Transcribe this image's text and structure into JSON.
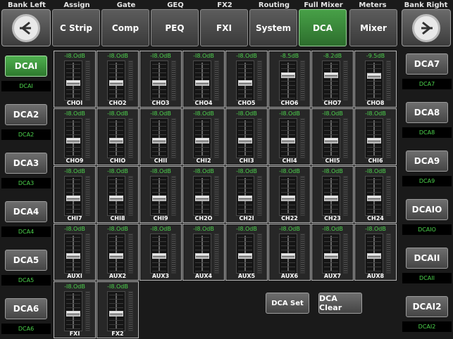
{
  "header": {
    "labels": [
      "Bank Left",
      "Assign",
      "Gate",
      "GEQ",
      "FX2",
      "Routing",
      "Full Mixer",
      "Meters",
      "Bank Right"
    ],
    "tabs": [
      {
        "label": "C Strip",
        "active": false
      },
      {
        "label": "Comp",
        "active": false
      },
      {
        "label": "PEQ",
        "active": false
      },
      {
        "label": "FXI",
        "active": false
      },
      {
        "label": "System",
        "active": false
      },
      {
        "label": "DCA",
        "active": true
      },
      {
        "label": "Mixer",
        "active": false
      }
    ],
    "bank_left_icon": "arrow-left-circle-icon",
    "bank_right_icon": "arrow-right-circle-icon"
  },
  "left_dca": [
    {
      "label": "DCAI",
      "tag": "DCAI",
      "active": true
    },
    {
      "label": "DCA2",
      "tag": "DCA2",
      "active": false
    },
    {
      "label": "DCA3",
      "tag": "DCA3",
      "active": false
    },
    {
      "label": "DCA4",
      "tag": "DCA4",
      "active": false
    },
    {
      "label": "DCA5",
      "tag": "DCA5",
      "active": false
    },
    {
      "label": "DCA6",
      "tag": "DCA6",
      "active": false
    }
  ],
  "right_dca": [
    {
      "label": "DCA7",
      "tag": "DCA7"
    },
    {
      "label": "DCA8",
      "tag": "DCA8"
    },
    {
      "label": "DCA9",
      "tag": "DCA9"
    },
    {
      "label": "DCAIO",
      "tag": "DCAIO"
    },
    {
      "label": "DCAII",
      "tag": "DCAII"
    },
    {
      "label": "DCAI2",
      "tag": "DCAI2"
    }
  ],
  "channels": [
    [
      {
        "name": "CHOI",
        "level": "-I8.OdB",
        "fader": 0.55
      },
      {
        "name": "CHO2",
        "level": "-I8.OdB",
        "fader": 0.55
      },
      {
        "name": "CHO3",
        "level": "-I8.OdB",
        "fader": 0.55
      },
      {
        "name": "CHO4",
        "level": "-I8.OdB",
        "fader": 0.55
      },
      {
        "name": "CHO5",
        "level": "-I8.OdB",
        "fader": 0.55
      },
      {
        "name": "CHO6",
        "level": "-8.5dB",
        "fader": 0.3
      },
      {
        "name": "CHO7",
        "level": "-8.2dB",
        "fader": 0.3
      },
      {
        "name": "CHO8",
        "level": "-9.5dB",
        "fader": 0.33
      }
    ],
    [
      {
        "name": "CHO9",
        "level": "-I8.OdB",
        "fader": 0.55
      },
      {
        "name": "CHIO",
        "level": "-I8.OdB",
        "fader": 0.55
      },
      {
        "name": "CHII",
        "level": "-I8.OdB",
        "fader": 0.55
      },
      {
        "name": "CHI2",
        "level": "-I8.OdB",
        "fader": 0.55
      },
      {
        "name": "CHI3",
        "level": "-I8.OdB",
        "fader": 0.55
      },
      {
        "name": "CHI4",
        "level": "-I8.OdB",
        "fader": 0.55
      },
      {
        "name": "CHI5",
        "level": "-I8.OdB",
        "fader": 0.55
      },
      {
        "name": "CHI6",
        "level": "-I8.OdB",
        "fader": 0.55
      }
    ],
    [
      {
        "name": "CHI7",
        "level": "-I8.OdB",
        "fader": 0.55
      },
      {
        "name": "CHI8",
        "level": "-I8.OdB",
        "fader": 0.55
      },
      {
        "name": "CHI9",
        "level": "-I8.OdB",
        "fader": 0.55
      },
      {
        "name": "CH2O",
        "level": "-I8.OdB",
        "fader": 0.55
      },
      {
        "name": "CH2I",
        "level": "-I8.OdB",
        "fader": 0.55
      },
      {
        "name": "CH22",
        "level": "-I8.OdB",
        "fader": 0.55
      },
      {
        "name": "CH23",
        "level": "-I8.OdB",
        "fader": 0.55
      },
      {
        "name": "CH24",
        "level": "-I8.OdB",
        "fader": 0.55
      }
    ],
    [
      {
        "name": "AUXI",
        "level": "-I8.OdB",
        "fader": 0.55
      },
      {
        "name": "AUX2",
        "level": "-I8.OdB",
        "fader": 0.55
      },
      {
        "name": "AUX3",
        "level": "-I8.OdB",
        "fader": 0.55
      },
      {
        "name": "AUX4",
        "level": "-I8.OdB",
        "fader": 0.55
      },
      {
        "name": "AUX5",
        "level": "-I8.OdB",
        "fader": 0.55
      },
      {
        "name": "AUX6",
        "level": "-I8.OdB",
        "fader": 0.55
      },
      {
        "name": "AUX7",
        "level": "-I8.OdB",
        "fader": 0.55
      },
      {
        "name": "AUX8",
        "level": "-I8.OdB",
        "fader": 0.55
      }
    ],
    [
      {
        "name": "FXI",
        "level": "-I8.OdB",
        "fader": 0.55
      },
      {
        "name": "FX2",
        "level": "-I8.OdB",
        "fader": 0.55
      }
    ]
  ],
  "actions": {
    "dca_set": "DCA Set",
    "dca_clear": "DCA Clear"
  },
  "colors": {
    "accent_green": "#4cd24c",
    "active_tab": "#3a8a3a",
    "background": "#1a1a1a"
  }
}
